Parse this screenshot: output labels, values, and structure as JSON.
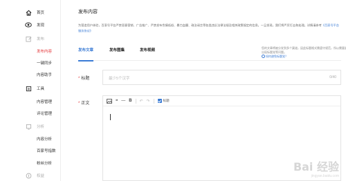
{
  "sidebar": {
    "items": [
      {
        "label": "首页",
        "icon": "home-icon"
      },
      {
        "label": "发现",
        "icon": "eye-icon"
      },
      {
        "label": "发布",
        "icon": "edit-icon",
        "section": true
      },
      {
        "label": "发布内容",
        "active": true
      },
      {
        "label": "一键同步"
      },
      {
        "label": "内容助手"
      },
      {
        "label": "工具",
        "icon": "tools-icon",
        "section": true
      },
      {
        "label": "内容管理"
      },
      {
        "label": "评论管理"
      },
      {
        "label": "分析",
        "icon": "chart-icon",
        "section": true
      },
      {
        "label": "内容分析"
      },
      {
        "label": "百家号指数"
      },
      {
        "label": "粉丝分析"
      },
      {
        "label": "权益",
        "icon": "coin-icon",
        "section": true
      }
    ]
  },
  "main": {
    "title": "发布内容",
    "notice_text": "为营造用户体验，百家号平台严禁恶意营销、广告推广、严禁发布色情低俗、暴力血腥、政治谣言等各类违反法律法规及相关政策规定的信息。一旦发现，我们将严厉打击和处理。详情请参考",
    "notice_link": "《百家号平台服务协议》",
    "tabs": [
      {
        "label": "发布文章",
        "active": true
      },
      {
        "label": "发布图集"
      },
      {
        "label": "发布视频"
      }
    ],
    "tab_hint": "您的文章将被分发到多个渠道，因此标题格式需遵守规范，所以需要避免出现标题党等问题。",
    "tab_hint_link": "如何避免标题党？",
    "title_field": {
      "label": "标题",
      "placeholder": "最少5个汉字",
      "counter": "0/40"
    },
    "body_field": {
      "label": "正文",
      "toolbar": {
        "image_icon": "image-icon",
        "quote": "❝",
        "divider_symbol": "—",
        "bold": "B",
        "undo": "↶",
        "redo": "↷",
        "heading_label": "标题"
      }
    }
  },
  "watermark": {
    "logo": "Bai 经验",
    "url": "jingyan.baidu.com"
  }
}
